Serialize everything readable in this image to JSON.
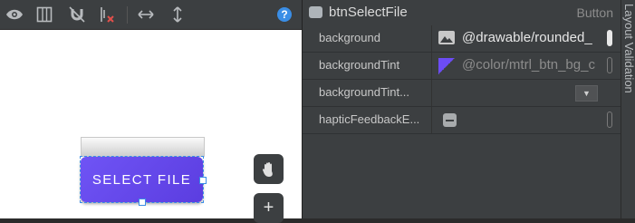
{
  "canvas": {
    "toolbar": {
      "icons": [
        "eye-icon",
        "blueprint-icon",
        "magnet-off-icon",
        "clear-constraints-icon",
        "horizontal-arrows-icon",
        "vertical-arrows-icon"
      ],
      "help": "?"
    },
    "button": {
      "label": "SELECT FILE",
      "color": "#6b4ff0"
    },
    "float_buttons": [
      "hand-icon",
      "plus-icon"
    ],
    "plus_glyph": "+"
  },
  "attributes": {
    "component_name": "btnSelectFile",
    "component_type": "Button",
    "rows": [
      {
        "name": "background",
        "value": "@drawable/rounded_",
        "icon": "image-icon"
      },
      {
        "name": "backgroundTint",
        "value": "@color/mtrl_btn_bg_c",
        "icon": "color-swatch-icon",
        "swatch_color": "#6c4cf5"
      },
      {
        "name": "backgroundTint...",
        "value": "",
        "control": "dropdown",
        "dropdown_glyph": "▼"
      },
      {
        "name": "hapticFeedbackE...",
        "value": "",
        "control": "checkbox-indeterminate"
      }
    ]
  },
  "side_panel": {
    "label": "Layout Validation"
  }
}
